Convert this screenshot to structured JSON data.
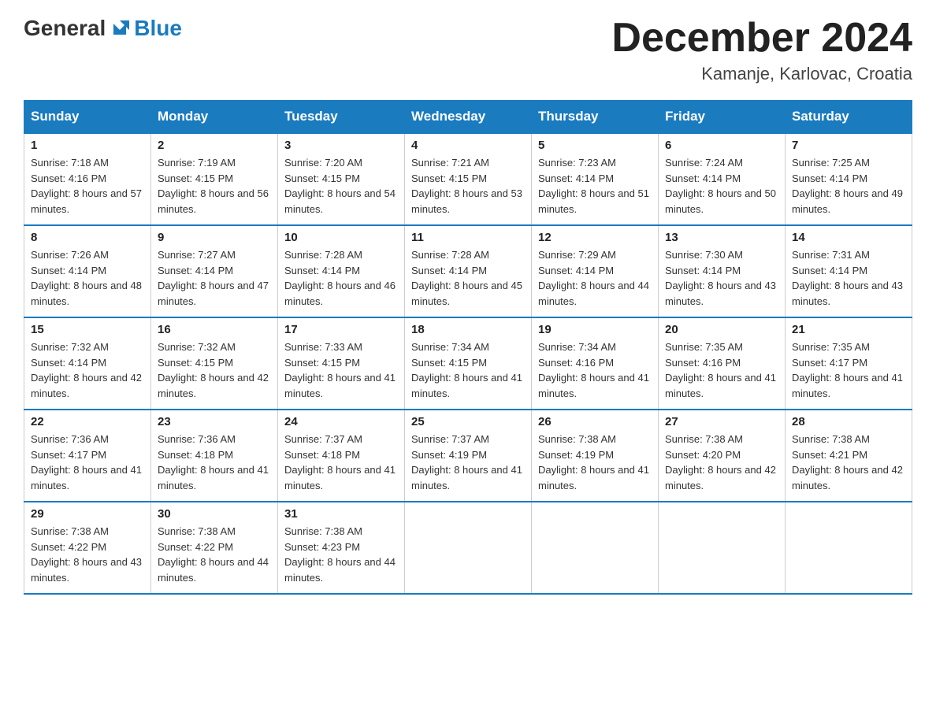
{
  "header": {
    "logo": {
      "general": "General",
      "blue": "Blue"
    },
    "title": "December 2024",
    "location": "Kamanje, Karlovac, Croatia"
  },
  "calendar": {
    "days_of_week": [
      "Sunday",
      "Monday",
      "Tuesday",
      "Wednesday",
      "Thursday",
      "Friday",
      "Saturday"
    ],
    "weeks": [
      [
        {
          "day": "1",
          "sunrise": "7:18 AM",
          "sunset": "4:16 PM",
          "daylight": "8 hours and 57 minutes."
        },
        {
          "day": "2",
          "sunrise": "7:19 AM",
          "sunset": "4:15 PM",
          "daylight": "8 hours and 56 minutes."
        },
        {
          "day": "3",
          "sunrise": "7:20 AM",
          "sunset": "4:15 PM",
          "daylight": "8 hours and 54 minutes."
        },
        {
          "day": "4",
          "sunrise": "7:21 AM",
          "sunset": "4:15 PM",
          "daylight": "8 hours and 53 minutes."
        },
        {
          "day": "5",
          "sunrise": "7:23 AM",
          "sunset": "4:14 PM",
          "daylight": "8 hours and 51 minutes."
        },
        {
          "day": "6",
          "sunrise": "7:24 AM",
          "sunset": "4:14 PM",
          "daylight": "8 hours and 50 minutes."
        },
        {
          "day": "7",
          "sunrise": "7:25 AM",
          "sunset": "4:14 PM",
          "daylight": "8 hours and 49 minutes."
        }
      ],
      [
        {
          "day": "8",
          "sunrise": "7:26 AM",
          "sunset": "4:14 PM",
          "daylight": "8 hours and 48 minutes."
        },
        {
          "day": "9",
          "sunrise": "7:27 AM",
          "sunset": "4:14 PM",
          "daylight": "8 hours and 47 minutes."
        },
        {
          "day": "10",
          "sunrise": "7:28 AM",
          "sunset": "4:14 PM",
          "daylight": "8 hours and 46 minutes."
        },
        {
          "day": "11",
          "sunrise": "7:28 AM",
          "sunset": "4:14 PM",
          "daylight": "8 hours and 45 minutes."
        },
        {
          "day": "12",
          "sunrise": "7:29 AM",
          "sunset": "4:14 PM",
          "daylight": "8 hours and 44 minutes."
        },
        {
          "day": "13",
          "sunrise": "7:30 AM",
          "sunset": "4:14 PM",
          "daylight": "8 hours and 43 minutes."
        },
        {
          "day": "14",
          "sunrise": "7:31 AM",
          "sunset": "4:14 PM",
          "daylight": "8 hours and 43 minutes."
        }
      ],
      [
        {
          "day": "15",
          "sunrise": "7:32 AM",
          "sunset": "4:14 PM",
          "daylight": "8 hours and 42 minutes."
        },
        {
          "day": "16",
          "sunrise": "7:32 AM",
          "sunset": "4:15 PM",
          "daylight": "8 hours and 42 minutes."
        },
        {
          "day": "17",
          "sunrise": "7:33 AM",
          "sunset": "4:15 PM",
          "daylight": "8 hours and 41 minutes."
        },
        {
          "day": "18",
          "sunrise": "7:34 AM",
          "sunset": "4:15 PM",
          "daylight": "8 hours and 41 minutes."
        },
        {
          "day": "19",
          "sunrise": "7:34 AM",
          "sunset": "4:16 PM",
          "daylight": "8 hours and 41 minutes."
        },
        {
          "day": "20",
          "sunrise": "7:35 AM",
          "sunset": "4:16 PM",
          "daylight": "8 hours and 41 minutes."
        },
        {
          "day": "21",
          "sunrise": "7:35 AM",
          "sunset": "4:17 PM",
          "daylight": "8 hours and 41 minutes."
        }
      ],
      [
        {
          "day": "22",
          "sunrise": "7:36 AM",
          "sunset": "4:17 PM",
          "daylight": "8 hours and 41 minutes."
        },
        {
          "day": "23",
          "sunrise": "7:36 AM",
          "sunset": "4:18 PM",
          "daylight": "8 hours and 41 minutes."
        },
        {
          "day": "24",
          "sunrise": "7:37 AM",
          "sunset": "4:18 PM",
          "daylight": "8 hours and 41 minutes."
        },
        {
          "day": "25",
          "sunrise": "7:37 AM",
          "sunset": "4:19 PM",
          "daylight": "8 hours and 41 minutes."
        },
        {
          "day": "26",
          "sunrise": "7:38 AM",
          "sunset": "4:19 PM",
          "daylight": "8 hours and 41 minutes."
        },
        {
          "day": "27",
          "sunrise": "7:38 AM",
          "sunset": "4:20 PM",
          "daylight": "8 hours and 42 minutes."
        },
        {
          "day": "28",
          "sunrise": "7:38 AM",
          "sunset": "4:21 PM",
          "daylight": "8 hours and 42 minutes."
        }
      ],
      [
        {
          "day": "29",
          "sunrise": "7:38 AM",
          "sunset": "4:22 PM",
          "daylight": "8 hours and 43 minutes."
        },
        {
          "day": "30",
          "sunrise": "7:38 AM",
          "sunset": "4:22 PM",
          "daylight": "8 hours and 44 minutes."
        },
        {
          "day": "31",
          "sunrise": "7:38 AM",
          "sunset": "4:23 PM",
          "daylight": "8 hours and 44 minutes."
        },
        null,
        null,
        null,
        null
      ]
    ]
  }
}
